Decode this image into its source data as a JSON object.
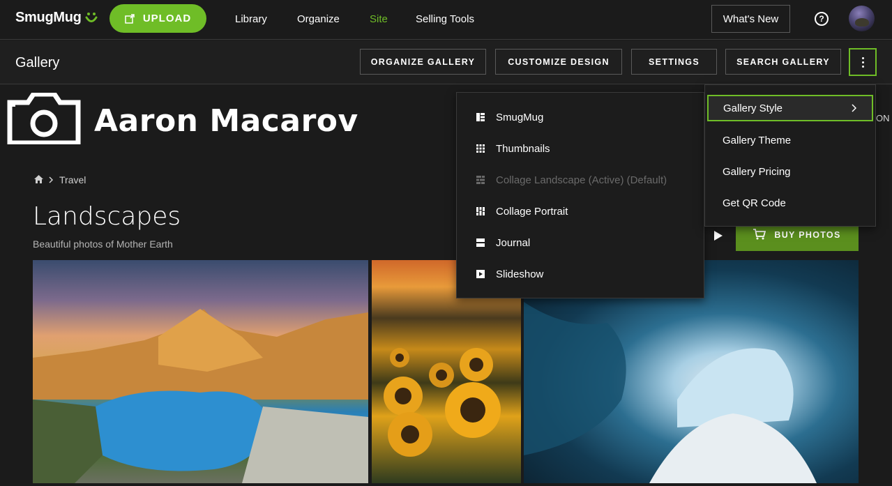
{
  "topnav": {
    "logo": "SmugMug",
    "upload_label": "UPLOAD",
    "links": [
      "Library",
      "Organize",
      "Site",
      "Selling Tools"
    ],
    "active_link": "Site",
    "whats_new": "What's New",
    "help": "?"
  },
  "subnav": {
    "title": "Gallery",
    "buttons": [
      "ORGANIZE GALLERY",
      "CUSTOMIZE DESIGN",
      "SETTINGS",
      "SEARCH GALLERY"
    ]
  },
  "site": {
    "brand_name": "Aaron Macarov",
    "breadcrumb": "Travel",
    "gallery_title": "Landscapes",
    "gallery_subtitle": "Beautiful photos of Mother Earth",
    "buy_label": "BUY PHOTOS",
    "partial_text": "ON"
  },
  "style_menu": {
    "items": [
      {
        "label": "SmugMug",
        "icon": "smugmug-style-icon",
        "disabled": false
      },
      {
        "label": "Thumbnails",
        "icon": "thumbnails-icon",
        "disabled": false
      },
      {
        "label": "Collage Landscape (Active) (Default)",
        "icon": "collage-landscape-icon",
        "disabled": true
      },
      {
        "label": "Collage Portrait",
        "icon": "collage-portrait-icon",
        "disabled": false
      },
      {
        "label": "Journal",
        "icon": "journal-icon",
        "disabled": false
      },
      {
        "label": "Slideshow",
        "icon": "slideshow-icon",
        "disabled": false
      }
    ]
  },
  "more_menu": {
    "items": [
      "Gallery Style",
      "Gallery Theme",
      "Gallery Pricing",
      "Get QR Code"
    ],
    "selected": "Gallery Style"
  },
  "colors": {
    "accent": "#6fbd27",
    "buy": "#5b8f1e",
    "background": "#1b1b1b"
  }
}
